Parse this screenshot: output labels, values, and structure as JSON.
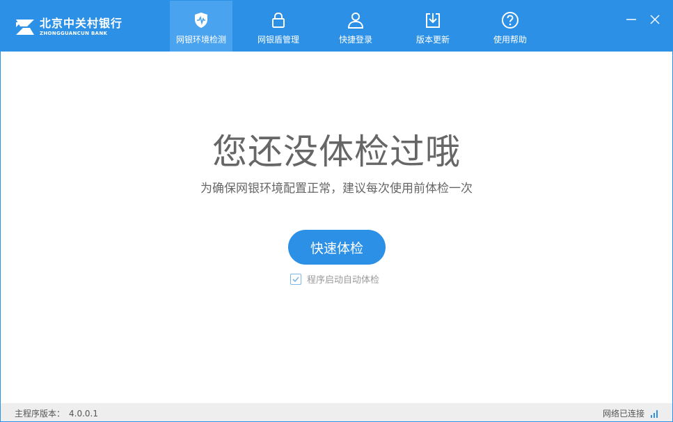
{
  "brand": {
    "name_cn": "北京中关村银行",
    "name_en": "ZHONGGUANCUN BANK"
  },
  "nav": {
    "items": [
      {
        "label": "网银环境检测",
        "icon": "shield-heartbeat-icon",
        "active": true
      },
      {
        "label": "网银盾管理",
        "icon": "lock-icon",
        "active": false
      },
      {
        "label": "快捷登录",
        "icon": "user-icon",
        "active": false
      },
      {
        "label": "版本更新",
        "icon": "download-icon",
        "active": false
      },
      {
        "label": "使用帮助",
        "icon": "help-icon",
        "active": false
      }
    ]
  },
  "main": {
    "headline": "您还没体检过哦",
    "subline": "为确保网银环境配置正常，建议每次使用前体检一次",
    "check_button": "快速体检",
    "auto_check_label": "程序启动自动体检",
    "auto_check_checked": true
  },
  "status": {
    "version_label": "主程序版本：",
    "version_value": "4.0.0.1",
    "network_text": "网络已连接"
  },
  "colors": {
    "primary": "#2b90e6",
    "active_tab": "#4aa3ef",
    "text_gray": "#666666",
    "statusbar_bg": "#eeeeee"
  }
}
